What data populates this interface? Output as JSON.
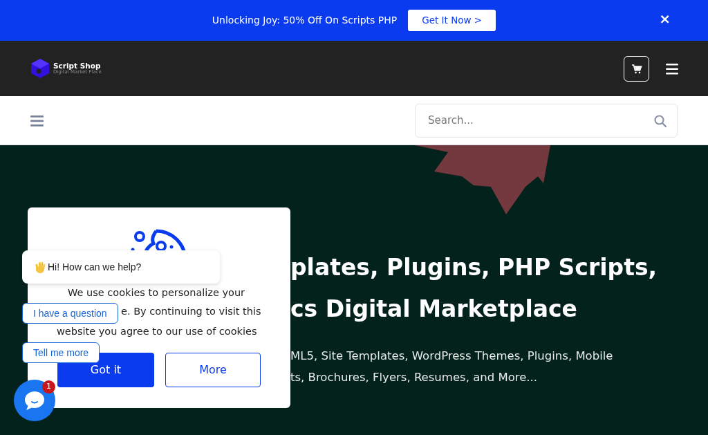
{
  "banner": {
    "text": "Unlocking Joy: 50% Off On Scripts PHP",
    "button": "Get It Now >",
    "close": "×"
  },
  "header": {
    "brand": "Script Shop",
    "tagline": "Digital Market Place"
  },
  "search": {
    "placeholder": "Search..."
  },
  "hero": {
    "headline_lines": [
      "plates, Plugins, PHP Scripts,",
      "cs Digital Marketplace"
    ],
    "description_lines": [
      "ML5, Site Templates, WordPress Themes, Plugins, Mobile",
      "ts, Brochures, Flyers, Resumes, and More..."
    ]
  },
  "cookie_notice": {
    "text_lines": [
      "We use cookies to personalize your",
      "e. By continuing to visit this",
      "website you agree to our use of cookies"
    ],
    "buttons": [
      "Got it",
      "More"
    ]
  },
  "chat": {
    "greeting": "Hi! How can we help?",
    "quick_replies": [
      "I have a question",
      "Tell me more"
    ],
    "unread_count": "1"
  }
}
